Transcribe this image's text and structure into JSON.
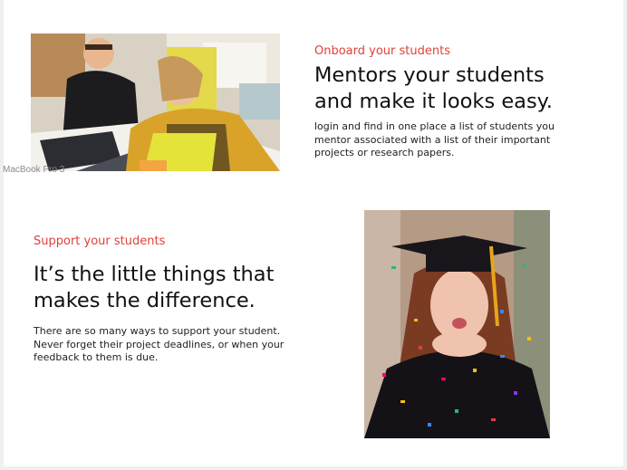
{
  "canvas": {
    "artboard_label": "MacBook Pro 3"
  },
  "section_onboard": {
    "eyebrow": "Onboard your students",
    "headline_line1": "Mentors your students",
    "headline_line2": "and make it looks easy.",
    "body_line1": "login and find in one place a list of students you",
    "body_line2": "mentor associated with a list of their important",
    "body_line3": "projects or research papers."
  },
  "section_support": {
    "eyebrow": "Support your students",
    "headline_line1": "It’s the little things that",
    "headline_line2": "makes the difference.",
    "body_line1": "There are so many ways to support your student.",
    "body_line2": "Never forget their project deadlines, or when your",
    "body_line3": "feedback to them is due."
  },
  "colors": {
    "accent": "#e2403a",
    "text": "#111111"
  }
}
